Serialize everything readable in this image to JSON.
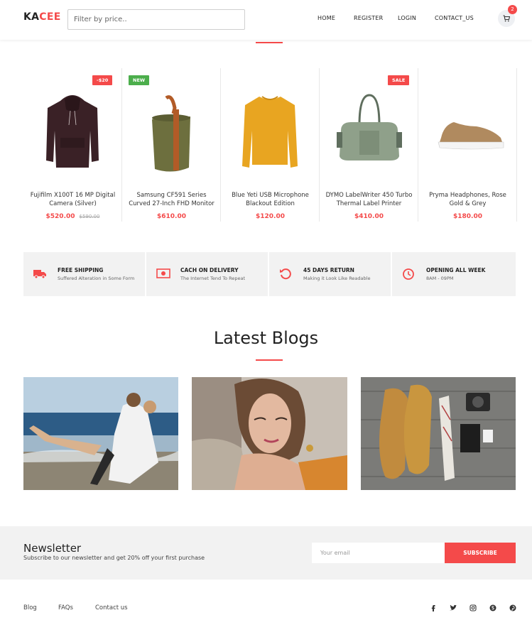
{
  "header": {
    "logo_prefix": "KA",
    "logo_suffix": "CEE",
    "filter_placeholder": "Filter by price..",
    "nav": [
      "HOME",
      "REGISTER",
      "LOGIN",
      "CONTACT_US"
    ],
    "cart_count": "2"
  },
  "products": [
    {
      "name": "Fujifilm X100T 16 MP Digital Camera (Silver)",
      "price": "$520.00",
      "old_price": "$590.00",
      "badge": "-$20",
      "icon": "hoodie-image"
    },
    {
      "name": "Samsung CF591 Series Curved 27-Inch FHD Monitor",
      "price": "$610.00",
      "old_price": "",
      "badge": "NEW",
      "icon": "bucket-bag-image"
    },
    {
      "name": "Blue Yeti USB Microphone Blackout Edition",
      "price": "$120.00",
      "old_price": "",
      "badge": "",
      "icon": "sweater-image"
    },
    {
      "name": "DYMO LabelWriter 450 Turbo Thermal Label Printer",
      "price": "$410.00",
      "old_price": "",
      "badge": "SALE",
      "icon": "duffel-bag-image"
    },
    {
      "name": "Pryma Headphones, Rose Gold & Grey",
      "price": "$180.00",
      "old_price": "",
      "badge": "",
      "icon": "sneaker-image"
    }
  ],
  "features": [
    {
      "title": "FREE SHIPPING",
      "subtitle": "Suffered Alteration in Some Form",
      "icon": "truck-icon"
    },
    {
      "title": "CACH ON DELIVERY",
      "subtitle": "The Internet Tend To Repeat",
      "icon": "cash-icon"
    },
    {
      "title": "45 DAYS RETURN",
      "subtitle": "Making it Look Like Readable",
      "icon": "return-icon"
    },
    {
      "title": "OPENING ALL WEEK",
      "subtitle": "8AM - 09PM",
      "icon": "clock-icon"
    }
  ],
  "blogs": {
    "title": "Latest Blogs",
    "items": [
      {
        "icon": "beach-couple-photo"
      },
      {
        "icon": "woman-portrait-photo"
      },
      {
        "icon": "shoes-flatlay-photo"
      }
    ]
  },
  "newsletter": {
    "title": "Newsletter",
    "subtitle": "Subscribe to our newsletter and get 20% off your first purchase",
    "email_placeholder": "Your email",
    "button": "SUBSCRIBE"
  },
  "footer": {
    "links": [
      "Blog",
      "FAQs",
      "Contact us"
    ],
    "social": [
      "facebook-icon",
      "twitter-icon",
      "instagram-icon",
      "skype-icon",
      "pinterest-icon"
    ]
  },
  "colors": {
    "accent": "#f44a4a",
    "badge_green": "#4cae4c",
    "panel": "#f2f2f2"
  }
}
